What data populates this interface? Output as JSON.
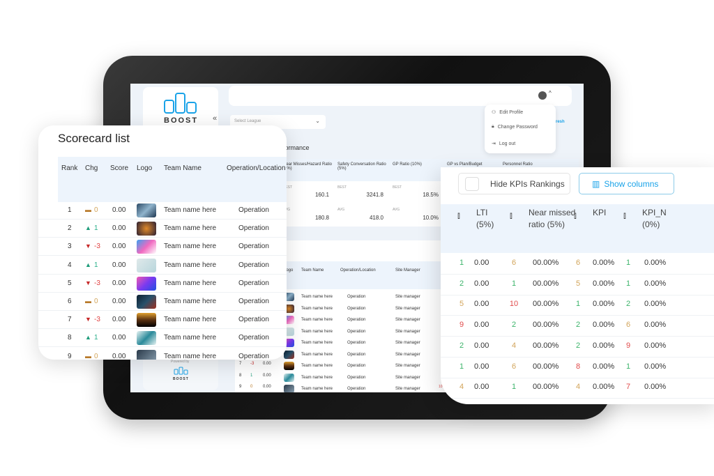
{
  "brand": {
    "name": "BOOST",
    "color": "#1aa3e8",
    "powered_by": "Powered by"
  },
  "header": {
    "select_league_placeholder": "Select League",
    "refresh_label": "resh",
    "collapse_icon": "double-chevron-left"
  },
  "profile_menu": {
    "items": [
      {
        "label": "Edit Profile",
        "icon": "user-icon"
      },
      {
        "label": "Change Password",
        "icon": "lock-icon"
      },
      {
        "label": "Log out",
        "icon": "logout-icon"
      }
    ]
  },
  "performance": {
    "title": "formance",
    "columns": [
      {
        "label": "Near Misses/Hazard Ratio (5%)",
        "best": "160.1",
        "avg": "180.8"
      },
      {
        "label": "Safety Conversation Ratio (5%)",
        "best": "3241.8",
        "avg": "418.0"
      },
      {
        "label": "GP Ratio (10%)",
        "best": "18.5%",
        "avg": "10.0%"
      },
      {
        "label": "GP vs Plan/Budget",
        "best": "",
        "avg": ""
      },
      {
        "label": "Personnel Ratio",
        "best": "",
        "avg": ""
      }
    ],
    "best_label": "BEST",
    "avg_label": "AVG"
  },
  "bg_table": {
    "headers": [
      "Logo",
      "Team Name",
      "Operation/Location",
      "Site Manager"
    ],
    "row": {
      "team": "Team name here",
      "operation": "Operation",
      "manager": "Site manager"
    },
    "left_rows": [
      {
        "rank": "7",
        "chg": "-3",
        "score": "0.00"
      },
      {
        "rank": "8",
        "chg": "1",
        "score": "0.00"
      },
      {
        "rank": "9",
        "chg": "0",
        "score": "0.00"
      }
    ],
    "edge_value": "10"
  },
  "scorecard": {
    "title": "Scorecard list",
    "headers": [
      "Rank",
      "Chg",
      "Score",
      "Logo",
      "Team Name",
      "Operation/Location"
    ],
    "rows": [
      {
        "rank": "1",
        "chg": "0",
        "dir": "same",
        "score": "0.00",
        "team": "Team name here",
        "op": "Operation"
      },
      {
        "rank": "2",
        "chg": "1",
        "dir": "up",
        "score": "0.00",
        "team": "Team name here",
        "op": "Operation"
      },
      {
        "rank": "3",
        "chg": "-3",
        "dir": "down",
        "score": "0.00",
        "team": "Team name here",
        "op": "Operation"
      },
      {
        "rank": "4",
        "chg": "1",
        "dir": "up",
        "score": "0.00",
        "team": "Team name here",
        "op": "Operation"
      },
      {
        "rank": "5",
        "chg": "-3",
        "dir": "down",
        "score": "0.00",
        "team": "Team name here",
        "op": "Operation"
      },
      {
        "rank": "6",
        "chg": "0",
        "dir": "same",
        "score": "0.00",
        "team": "Team name here",
        "op": "Operation"
      },
      {
        "rank": "7",
        "chg": "-3",
        "dir": "down",
        "score": "0.00",
        "team": "Team name here",
        "op": "Operation"
      },
      {
        "rank": "8",
        "chg": "1",
        "dir": "up",
        "score": "0.00",
        "team": "Team name here",
        "op": "Operation"
      },
      {
        "rank": "9",
        "chg": "0",
        "dir": "same",
        "score": "0.00",
        "team": "Team name here",
        "op": "Operation"
      }
    ]
  },
  "kpi_panel": {
    "hide_rankings_label": "Hide KPIs Rankings",
    "hide_rankings_checked": false,
    "show_columns_label": "Show columns",
    "headers": [
      "LTI (5%)",
      "Near missed ratio (5%)",
      "KPI",
      "KPI_N (0%)"
    ],
    "rows": [
      [
        [
          "1",
          "0.00"
        ],
        [
          "6",
          "00.00%"
        ],
        [
          "6",
          "0.00%"
        ],
        [
          "1",
          "0.00%"
        ]
      ],
      [
        [
          "2",
          "0.00"
        ],
        [
          "1",
          "00.00%"
        ],
        [
          "5",
          "0.00%"
        ],
        [
          "1",
          "0.00%"
        ]
      ],
      [
        [
          "5",
          "0.00"
        ],
        [
          "10",
          "00.00%"
        ],
        [
          "1",
          "0.00%"
        ],
        [
          "2",
          "0.00%"
        ]
      ],
      [
        [
          "9",
          "0.00"
        ],
        [
          "2",
          "00.00%"
        ],
        [
          "2",
          "0.00%"
        ],
        [
          "6",
          "0.00%"
        ]
      ],
      [
        [
          "2",
          "0.00"
        ],
        [
          "4",
          "00.00%"
        ],
        [
          "2",
          "0.00%"
        ],
        [
          "9",
          "0.00%"
        ]
      ],
      [
        [
          "1",
          "0.00"
        ],
        [
          "6",
          "00.00%"
        ],
        [
          "8",
          "0.00%"
        ],
        [
          "1",
          "0.00%"
        ]
      ],
      [
        [
          "4",
          "0.00"
        ],
        [
          "1",
          "00.00%"
        ],
        [
          "4",
          "0.00%"
        ],
        [
          "7",
          "0.00%"
        ]
      ]
    ]
  },
  "colors": {
    "up": "#1e9c7a",
    "down": "#c62828",
    "same": "#b87a2a",
    "rank_good": "#3bb36a",
    "rank_mid": "#d2a45a",
    "rank_bad": "#e04a4a",
    "header_bg": "#edf4fc"
  }
}
